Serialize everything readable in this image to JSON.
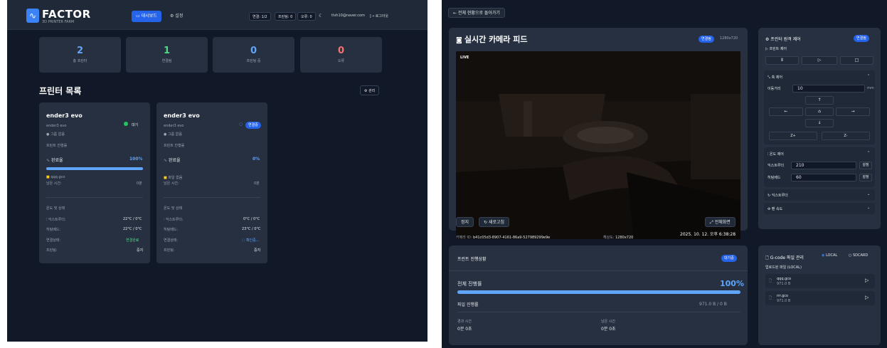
{
  "dashboard": {
    "logo": {
      "title": "FACTOR",
      "subtitle": "3D PRINTER FARM"
    },
    "nav": {
      "dashboard": "대시보드",
      "settings": "설정"
    },
    "status_pills": {
      "connection": "연결: 1/2",
      "printing": "프린팅: 0",
      "error": "오류: 0"
    },
    "user_email": "tlvh10@naver.com",
    "logout": "로그아웃",
    "stats": [
      {
        "value": "2",
        "label": "총 프린터",
        "color": "#60a5fa"
      },
      {
        "value": "1",
        "label": "연결됨",
        "color": "#4ade80"
      },
      {
        "value": "0",
        "label": "프린팅 중",
        "color": "#60a5fa"
      },
      {
        "value": "0",
        "label": "오류",
        "color": "#f87171"
      }
    ],
    "section_title": "프린터 목록",
    "manage_button": "관리",
    "printers": [
      {
        "name": "ender3 evo",
        "model": "ender3 evo",
        "group": "그룹 없음",
        "status": "대기",
        "status_color": "#22c55e",
        "progress_label": "프린트 진행률",
        "completion_label": "완료율",
        "progress": "100%",
        "progress_value": 100,
        "file": "qqq.gco",
        "remaining_label": "남은 시간:",
        "remaining": "0분",
        "temp_label": "온도 및 상태",
        "extruder_label": "익스트루더:",
        "extruder": "22°C / 0°C",
        "bed_label": "히팅베드:",
        "bed": "22°C / 0°C",
        "conn_label": "연결상태:",
        "conn": "연결완료",
        "conn_color": "#4ade80",
        "printer_label": "프린팅:",
        "printer_state": "중지"
      },
      {
        "name": "ender3 evo",
        "model": "ender3 evo",
        "group": "그룹 없음",
        "status": "연결중",
        "status_color": "#2563eb",
        "progress_label": "프린트 진행률",
        "completion_label": "완료율",
        "progress": "0%",
        "progress_value": 0,
        "file": "파일 없음",
        "remaining_label": "남은 시간:",
        "remaining": "0분",
        "temp_label": "온도 및 상태",
        "extruder_label": "익스트루더:",
        "extruder": "0°C / 0°C",
        "bed_label": "히팅베드:",
        "bed": "23°C / 0°C",
        "conn_label": "연결상태:",
        "conn": "확인중...",
        "conn_color": "#60a5fa",
        "printer_label": "프린팅:",
        "printer_state": "중지"
      }
    ]
  },
  "detail": {
    "back": "전체 현황으로 돌아가기",
    "camera": {
      "title": "실시간 카메라 피드",
      "badge": "연결됨",
      "resolution_top": "1280x720",
      "live": "LIVE",
      "timestamp": "2025. 10. 12. 오후 6:38:28",
      "stop": "정지",
      "refresh": "새로고침",
      "fullscreen": "전체화면",
      "camera_id_label": "카메라 ID:",
      "camera_id": "b41c05d3-8907-4161-86a9-527989299e9e",
      "res_label": "해상도:",
      "res": "1280x720"
    },
    "progress": {
      "title": "프린트 진행상황",
      "badge": "대기중",
      "overall_label": "전체 진행률",
      "overall": "100%",
      "overall_value": 100,
      "file_label": "파일 진행률",
      "file_value": "971.0 B / 0 B",
      "elapsed_label": "경과 시간",
      "elapsed": "0분 0초",
      "remaining_label": "남은 시간",
      "remaining": "0분 0초"
    },
    "remote": {
      "title": "프린터 원격 제어",
      "badge": "연결됨",
      "print_control": "프린트 제어",
      "axis_title": "축 제어",
      "distance_label": "이동거리",
      "distance": "10",
      "unit": "mm",
      "z_plus": "Z+",
      "z_minus": "Z-",
      "temp_title": "온도 제어",
      "extruder_label": "익스트루더",
      "extruder_value": "210",
      "bed_label": "히팅베드",
      "bed_value": "60",
      "set": "설정",
      "extruder_section": "익스트루더",
      "fan_section": "팬 속도"
    },
    "gcode": {
      "title": "G-code 파일 관리",
      "local": "LOCAL",
      "sdcard": "SDCARD",
      "uploaded": "업로드된 파일 (LOCAL)",
      "files": [
        {
          "name": "qqq.gco",
          "size": "971.0 B"
        },
        {
          "name": "rrr.gco",
          "size": "971.0 B"
        }
      ]
    }
  },
  "colors": {
    "accent": "#2563eb",
    "success": "#22c55e",
    "panel": "#263041",
    "background": "#111827"
  }
}
